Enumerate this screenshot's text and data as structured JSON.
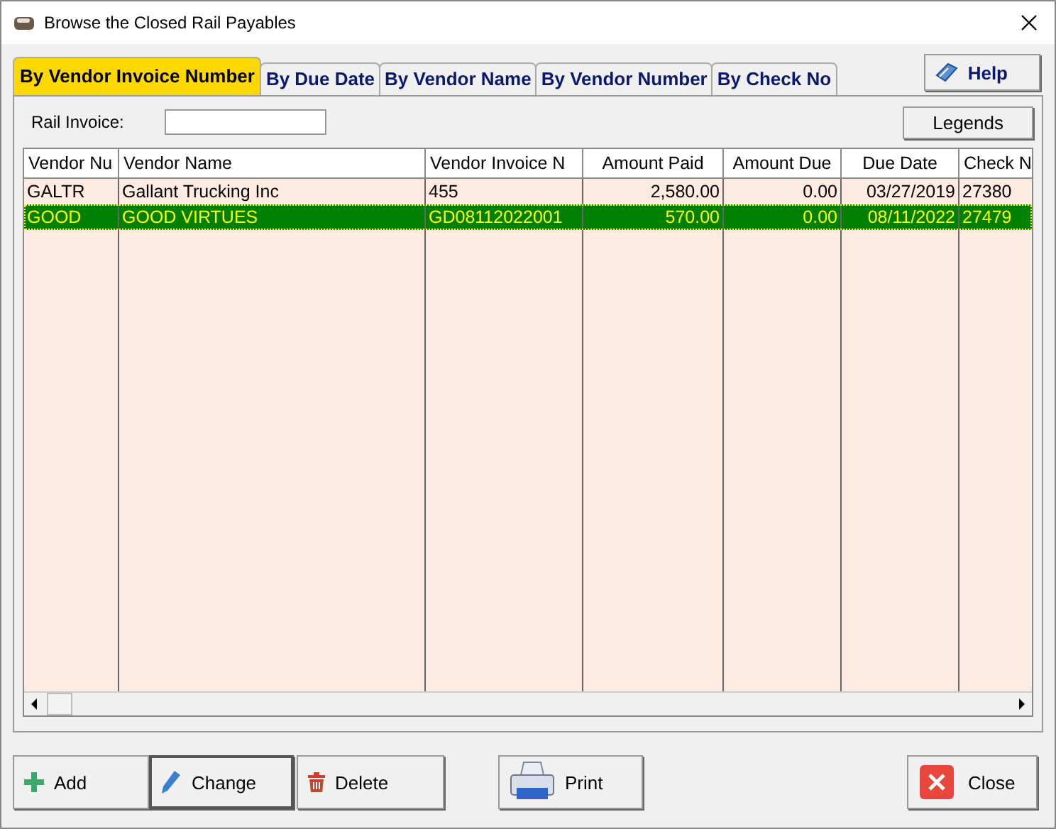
{
  "window": {
    "title": "Browse the Closed Rail Payables"
  },
  "tabs": [
    {
      "label": "By Vendor Invoice Number",
      "selected": true
    },
    {
      "label": "By Due Date",
      "selected": false
    },
    {
      "label": "By Vendor Name",
      "selected": false
    },
    {
      "label": "By Vendor Number",
      "selected": false
    },
    {
      "label": "By Check No",
      "selected": false
    }
  ],
  "help_button": "Help",
  "search": {
    "label": "Rail Invoice:"
  },
  "legends_button": "Legends",
  "table": {
    "columns": [
      {
        "label": "Vendor Nu"
      },
      {
        "label": "Vendor Name"
      },
      {
        "label": "Vendor Invoice N"
      },
      {
        "label": "Amount Paid"
      },
      {
        "label": "Amount Due"
      },
      {
        "label": "Due Date"
      },
      {
        "label": "Check N"
      }
    ],
    "rows": [
      {
        "selected": false,
        "cells": [
          "GALTR",
          "Gallant Trucking Inc",
          "455",
          "2,580.00",
          "0.00",
          "03/27/2019",
          "27380"
        ]
      },
      {
        "selected": true,
        "cells": [
          "GOOD",
          "GOOD VIRTUES",
          "GD08112022001",
          "570.00",
          "0.00",
          "08/11/2022",
          "27479"
        ]
      }
    ]
  },
  "buttons": [
    {
      "label": "Add",
      "kind": "add"
    },
    {
      "label": "Change",
      "kind": "change"
    },
    {
      "label": "Delete",
      "kind": "delete"
    },
    {
      "label": "Print",
      "kind": "print"
    },
    {
      "label": "Close",
      "kind": "close"
    }
  ]
}
